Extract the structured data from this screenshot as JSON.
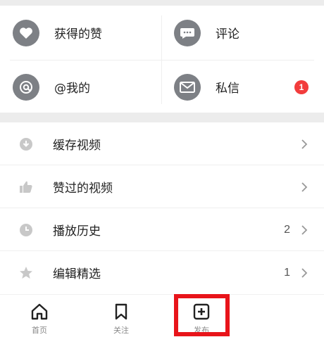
{
  "grid": {
    "likes_label": "获得的赞",
    "comments_label": "评论",
    "mentions_label": "@我的",
    "messages_label": "私信",
    "messages_badge": "1"
  },
  "list": {
    "items": [
      {
        "label": "缓存视频",
        "count": "",
        "icon": "download-icon"
      },
      {
        "label": "赞过的视频",
        "count": "",
        "icon": "thumbs-up-icon"
      },
      {
        "label": "播放历史",
        "count": "2",
        "icon": "clock-icon"
      },
      {
        "label": "编辑精选",
        "count": "1",
        "icon": "star-icon"
      }
    ]
  },
  "tabbar": {
    "home_label": "首页",
    "follow_label": "关注",
    "publish_label": "发布"
  },
  "colors": {
    "icon_gray": "#7d8085",
    "badge_red": "#f23c3c",
    "highlight_red": "#e8141a"
  }
}
